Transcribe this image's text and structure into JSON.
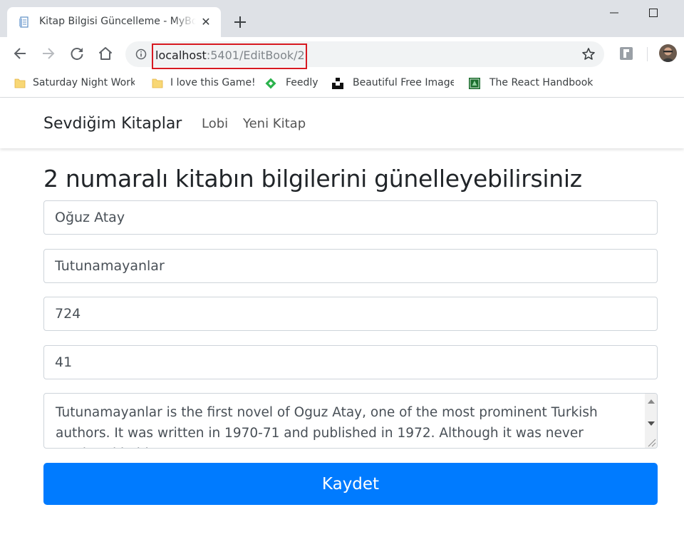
{
  "browser": {
    "tab_title": "Kitap Bilgisi Güncelleme - MyBooks",
    "tab_close_glyph": "✕",
    "url_host": "localhost",
    "url_path": ":5401/EditBook/2",
    "bookmarks": [
      {
        "label": "Saturday Night Works",
        "icon": "folder-icon"
      },
      {
        "label": "I love this Game!",
        "icon": "folder-icon"
      },
      {
        "label": "Feedly",
        "icon": "feedly-icon"
      },
      {
        "label": "Beautiful Free Images",
        "icon": "unsplash-icon"
      },
      {
        "label": "The React Handbook",
        "icon": "book-icon"
      }
    ],
    "colors": {
      "frame": "#dee1e6",
      "url_highlight": "#d71921"
    }
  },
  "navbar": {
    "brand": "Sevdiğim Kitaplar",
    "links": [
      "Lobi",
      "Yeni Kitap"
    ]
  },
  "form": {
    "heading": "2 numaralı kitabın bilgilerini günelleyebilirsiniz",
    "author": "Oğuz Atay",
    "title": "Tutunamayanlar",
    "pages": "724",
    "field4": "41",
    "summary": "Tutunamayanlar is the first novel of Oguz Atay, one of the most prominent Turkish authors. It was written in 1970-71 and published in 1972. Although it was never reprinted in his",
    "submit_label": "Kaydet",
    "colors": {
      "primary": "#007bff"
    }
  }
}
